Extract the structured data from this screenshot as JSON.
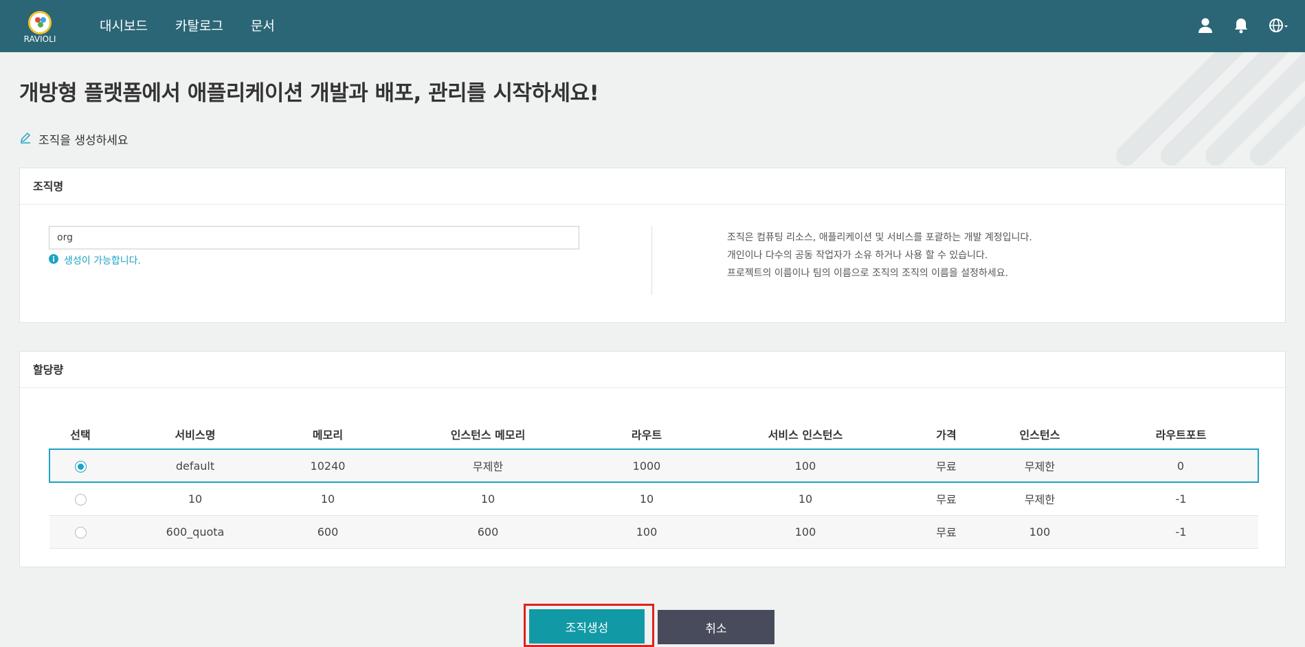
{
  "header": {
    "logo_text": "RAVIOLI",
    "nav": [
      "대시보드",
      "카탈로그",
      "문서"
    ],
    "icons": [
      "user-icon",
      "bell-icon",
      "globe-icon"
    ]
  },
  "page": {
    "title": "개방형 플랫폼에서 애플리케이션 개발과 배포, 관리를 시작하세요!",
    "subtitle": "조직을 생성하세요"
  },
  "org_panel": {
    "heading": "조직명",
    "input_value": "org",
    "hint": "생성이 가능합니다.",
    "description": [
      "조직은 컴퓨팅 리소스, 애플리케이션 및 서비스를 포괄하는 개발 계정입니다.",
      "개인이나 다수의 공동 작업자가 소유 하거나 사용 할 수 있습니다.",
      "프로젝트의 이름이나 팀의 이름으로 조직의 조직의 이름을 설정하세요."
    ]
  },
  "quota_panel": {
    "heading": "할당량",
    "columns": [
      "선택",
      "서비스명",
      "메모리",
      "인스턴스 메모리",
      "라우트",
      "서비스 인스턴스",
      "가격",
      "인스턴스",
      "라우트포트"
    ],
    "rows": [
      {
        "selected": true,
        "cells": [
          "default",
          "10240",
          "무제한",
          "1000",
          "100",
          "무료",
          "무제한",
          "0"
        ]
      },
      {
        "selected": false,
        "cells": [
          "10",
          "10",
          "10",
          "10",
          "10",
          "무료",
          "무제한",
          "-1"
        ]
      },
      {
        "selected": false,
        "cells": [
          "600_quota",
          "600",
          "600",
          "100",
          "100",
          "무료",
          "100",
          "-1"
        ]
      }
    ]
  },
  "actions": {
    "create_label": "조직생성",
    "cancel_label": "취소"
  },
  "colors": {
    "header_bg": "#2b6676",
    "accent": "#1ba3c6",
    "primary_button": "#119aa6",
    "cancel_button": "#474b5b",
    "highlight_border": "#e0201f"
  }
}
